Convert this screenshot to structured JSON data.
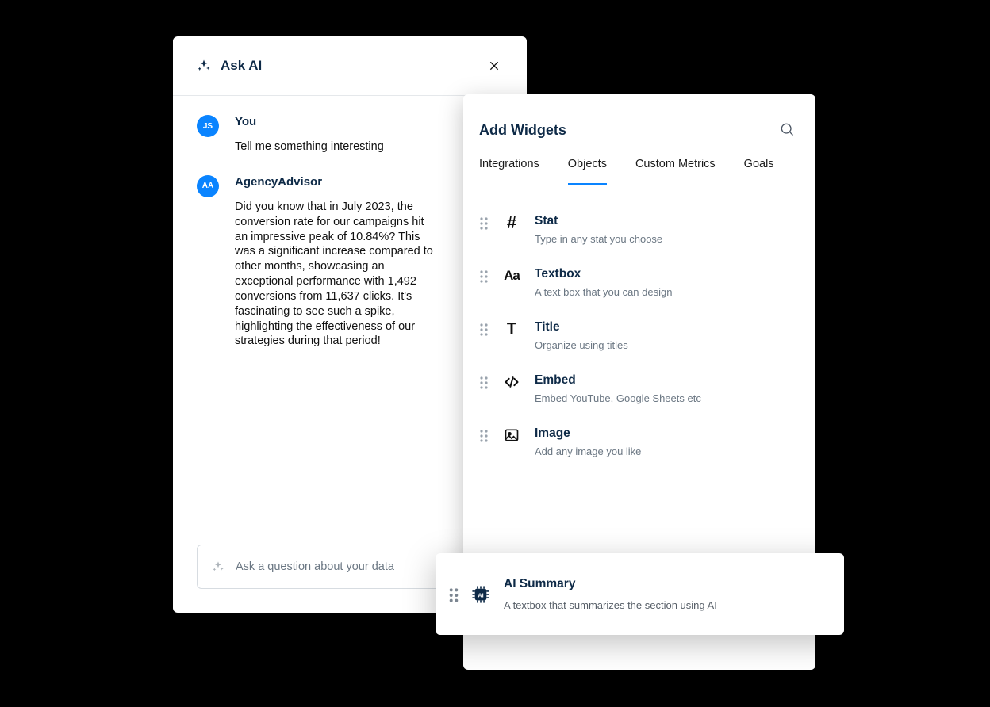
{
  "ask": {
    "title": "Ask AI",
    "input_placeholder": "Ask a question about your data",
    "messages": [
      {
        "avatar": "JS",
        "sender": "You",
        "text": "Tell me something interesting"
      },
      {
        "avatar": "AA",
        "sender": "AgencyAdvisor",
        "text": "Did you know that in July 2023, the conversion rate for our campaigns hit an impressive peak of 10.84%? This was a significant increase compared to other months, showcasing an exceptional performance with 1,492 conversions from 11,637 clicks. It's fascinating to see such a spike, highlighting the effectiveness of our strategies during that period!"
      }
    ]
  },
  "widgets": {
    "title": "Add Widgets",
    "tabs": [
      "Integrations",
      "Objects",
      "Custom Metrics",
      "Goals"
    ],
    "active_tab_index": 1,
    "items": [
      {
        "title": "Stat",
        "desc": "Type in any stat you choose"
      },
      {
        "title": "Textbox",
        "desc": "A text box that you can design"
      },
      {
        "title": "Title",
        "desc": "Organize using titles"
      },
      {
        "title": "Embed",
        "desc": "Embed YouTube, Google Sheets etc"
      },
      {
        "title": "Image",
        "desc": "Add any image you like"
      }
    ],
    "summary": {
      "title": "AI Summary",
      "desc": "A textbox that summarizes the section using AI"
    }
  }
}
